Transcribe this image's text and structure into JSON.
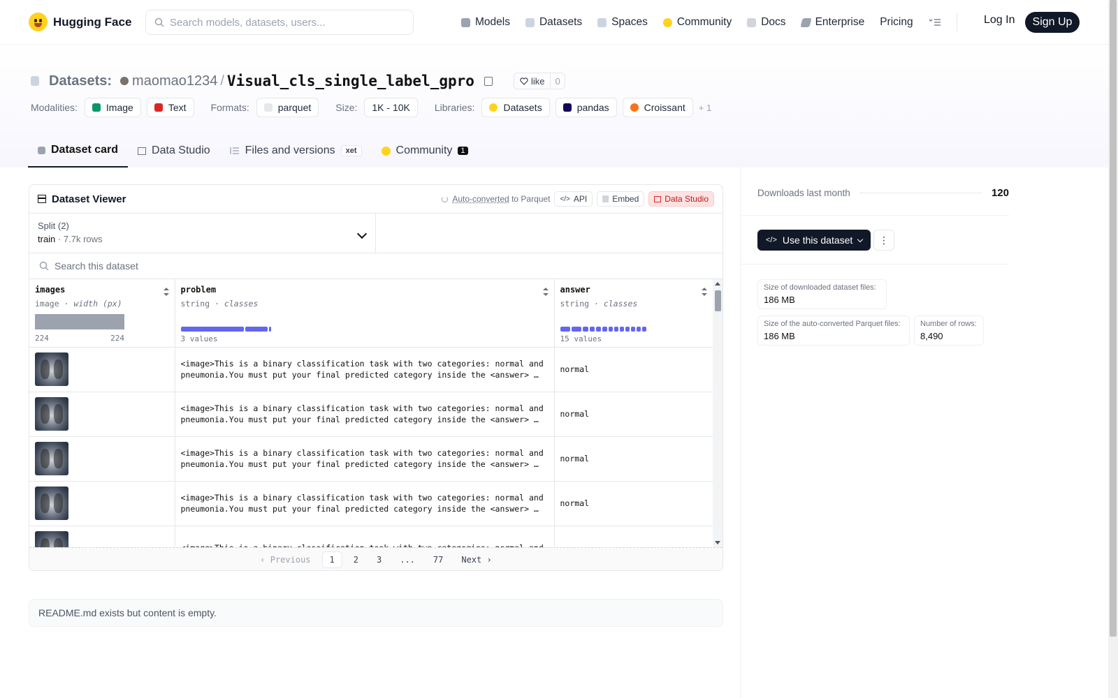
{
  "nav": {
    "brand": "Hugging Face",
    "search_placeholder": "Search models, datasets, users...",
    "links": [
      {
        "label": "Models",
        "icon": "cube-icon",
        "color": "#9ca3af"
      },
      {
        "label": "Datasets",
        "icon": "database-icon",
        "color": "#cbd5e1"
      },
      {
        "label": "Spaces",
        "icon": "grid-icon",
        "color": "#cbd5e1"
      },
      {
        "label": "Community",
        "icon": "hug-icon",
        "color": "#FFD21E"
      },
      {
        "label": "Docs",
        "icon": "book-icon",
        "color": "#d1d5db"
      },
      {
        "label": "Enterprise",
        "icon": "enterprise-icon",
        "color": "#9ca3af"
      },
      {
        "label": "Pricing"
      }
    ],
    "login": "Log In",
    "signup": "Sign Up"
  },
  "header": {
    "section": "Datasets:",
    "user": "maomao1234",
    "sep": "/",
    "name": "Visual_cls_single_label_gpro",
    "like_label": "like",
    "like_count": "0",
    "modalities_label": "Modalities:",
    "modalities": [
      "Image",
      "Text"
    ],
    "formats_label": "Formats:",
    "formats": [
      "parquet"
    ],
    "size_label": "Size:",
    "size": "1K - 10K",
    "libraries_label": "Libraries:",
    "libraries": [
      "Datasets",
      "pandas",
      "Croissant"
    ],
    "libraries_more": "+ 1",
    "tabs": {
      "card": "Dataset card",
      "studio": "Data Studio",
      "files": "Files and versions",
      "xet": "xet",
      "community": "Community",
      "community_count": "1"
    }
  },
  "viewer": {
    "title": "Dataset Viewer",
    "auto_converted": "Auto-converted",
    "to_parquet": "to Parquet",
    "api": "API",
    "embed": "Embed",
    "data_studio": "Data Studio",
    "split_label": "Split (2)",
    "split_name": "train",
    "split_dot": "·",
    "split_rows": "7.7k rows",
    "search_placeholder": "Search this dataset",
    "columns": {
      "images": {
        "name": "images",
        "type": "image",
        "sub": "width (px)",
        "min": "224",
        "max": "224"
      },
      "problem": {
        "name": "problem",
        "type": "string",
        "sub": "classes",
        "summary": "3 values"
      },
      "answer": {
        "name": "answer",
        "type": "string",
        "sub": "classes",
        "summary": "15 values"
      }
    },
    "type_dot": " · ",
    "rows": [
      {
        "problem": "<image>This is a binary classification task with two categories: normal and pneumonia.You must put your final predicted category inside the <answer> …",
        "answer": "normal"
      },
      {
        "problem": "<image>This is a binary classification task with two categories: normal and pneumonia.You must put your final predicted category inside the <answer> …",
        "answer": "normal"
      },
      {
        "problem": "<image>This is a binary classification task with two categories: normal and pneumonia.You must put your final predicted category inside the <answer> …",
        "answer": "normal"
      },
      {
        "problem": "<image>This is a binary classification task with two categories: normal and pneumonia.You must put your final predicted category inside the <answer> …",
        "answer": "normal"
      },
      {
        "problem": "<image>This is a binary classification task with two categories: normal and",
        "answer": ""
      }
    ],
    "pager": {
      "prev": "Previous",
      "pages": [
        "1",
        "2",
        "3",
        "...",
        "77"
      ],
      "next": "Next"
    }
  },
  "readme": "README.md exists but content is empty.",
  "sidebar": {
    "downloads_label": "Downloads last month",
    "downloads_value": "120",
    "use_button": "Use this dataset",
    "more": "⋮",
    "stats": {
      "dl_size_label": "Size of downloaded dataset files:",
      "dl_size": "186 MB",
      "pq_size_label": "Size of the auto-converted Parquet files:",
      "pq_size": "186 MB",
      "rows_label": "Number of rows:",
      "rows": "8,490"
    }
  },
  "colors": {
    "accent": "#6366f1",
    "dark": "#111827",
    "hf_yellow": "#FFD21E",
    "studio_red": "#b91c1c"
  }
}
